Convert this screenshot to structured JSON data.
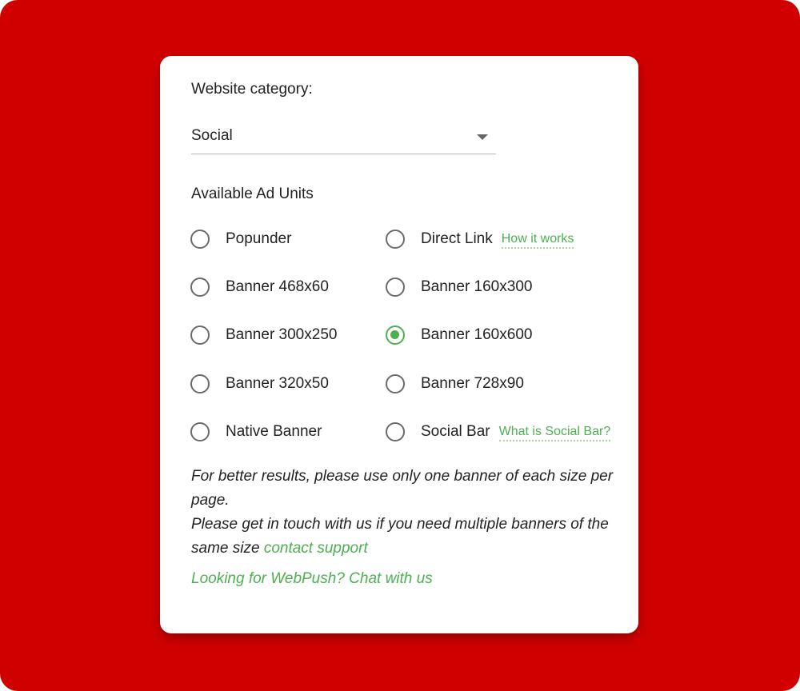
{
  "form": {
    "category_label": "Website category:",
    "category_value": "Social",
    "units_title": "Available Ad Units",
    "options": [
      {
        "label": "Popunder",
        "checked": false
      },
      {
        "label": "Direct Link",
        "checked": false,
        "help": "How it works"
      },
      {
        "label": "Banner 468x60",
        "checked": false
      },
      {
        "label": "Banner 160x300",
        "checked": false
      },
      {
        "label": "Banner 300x250",
        "checked": false
      },
      {
        "label": "Banner 160x600",
        "checked": true
      },
      {
        "label": "Banner 320x50",
        "checked": false
      },
      {
        "label": "Banner 728x90",
        "checked": false
      },
      {
        "label": "Native Banner",
        "checked": false
      },
      {
        "label": "Social Bar",
        "checked": false,
        "help": "What is Social Bar?"
      }
    ],
    "note_line1": "For better results, please use only one banner of each size per page.",
    "note_line2": "Please get in touch with us if you need multiple banners of the same size",
    "contact_link": "contact support",
    "webpush_link": "Looking for WebPush? Chat with us"
  },
  "colors": {
    "background": "#d10000",
    "accent": "#4caf50",
    "card": "#ffffff"
  }
}
